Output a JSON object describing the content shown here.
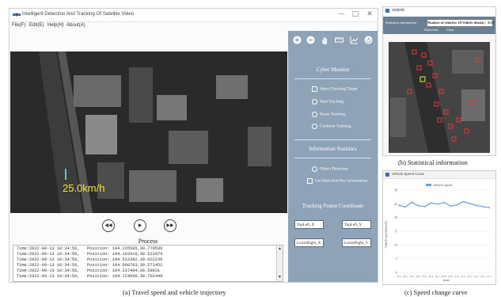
{
  "main_window": {
    "title": "Intelligent Detection And Tracking Of Satellite Video",
    "window_controls": {
      "minimize": "—",
      "maximize": "□",
      "close": "✕"
    },
    "menu": [
      "File(F)",
      "Edit(E)",
      "Help(H)",
      "About(A)"
    ],
    "toolbar_icons": [
      "plus-circle-icon",
      "minus-circle-icon",
      "hand-icon",
      "ruler-icon",
      "chart-line-icon",
      "power-icon"
    ],
    "video": {
      "speed_label": "25.0km/h"
    },
    "playback": {
      "rewind": "◀◀",
      "play": "▶",
      "forward": "▶▶"
    },
    "process": {
      "title": "Process",
      "log": [
        "Time:2022-09-13 10:34:56,   Position: 104.235585,30.779536",
        "Time:2022-09-13 10:34:56,   Position: 104.162919,30.522074",
        "Time:2022-09-13 10:34:56,   Position: 104.512392,30.022239",
        "Time:2022-09-13 10:34:56,   Position: 104.908703,30.571451",
        "Time:2022-09-13 10:34:56,   Position: 104.237484,30.58831",
        "Time:2022-09-13 10:34:56,   Position: 104.724696,30.702449"
      ]
    },
    "panel": {
      "cyber_monitor": {
        "title": "Cyber Monitor",
        "options": [
          "Select Tracking Target",
          "Start Tracking",
          "Pause Tracking",
          "Continue Tracking"
        ]
      },
      "information_statistics": {
        "title": "Information Statistics",
        "options": [
          "Object Detection",
          "Get Detection Box Information"
        ]
      },
      "tracking_frame": {
        "title": "Tracking Frame Coordinate",
        "fields": [
          "TopLeft_X",
          "TopLeft_Y",
          "LowerRight_X",
          "LowerRight_Y"
        ]
      }
    }
  },
  "statistics_window": {
    "title": "statistic",
    "label": "Statistical information",
    "summary": "Number of vehicles: 18  Vehicle density：0.53",
    "actions": [
      "Detection",
      "Clear"
    ]
  },
  "speed_window": {
    "title": "Vehicle Speed Curve",
    "chart_data": {
      "type": "line",
      "legend": "vehicle speed",
      "ylabel": "Vehicle speed (km/h)",
      "xlabel": "time",
      "ylim": [
        0,
        30
      ],
      "yticks": [
        "0",
        "5",
        "10",
        "15",
        "20",
        "25",
        "30"
      ],
      "x": [
        "00.1",
        "00.2",
        "00.3",
        "00.4",
        "00.5",
        "00.6",
        "00.7",
        "00.8",
        "00.9",
        "01.0",
        "01.1",
        "01.2",
        "01.3",
        "01.4",
        "01.5"
      ],
      "series": [
        {
          "name": "vehicle speed",
          "values": [
            24.5,
            23.8,
            25.6,
            24.3,
            24.0,
            25.3,
            24.9,
            25.5,
            24.2,
            24.6,
            25.8,
            25.1,
            24.4,
            24.0,
            23.6
          ]
        }
      ],
      "color": "#6a9fd6"
    }
  },
  "captions": {
    "a": "(a) Travel speed and vehicle trajectory",
    "b": "(b) Statistical information",
    "c": "(c) Speed change curve"
  }
}
